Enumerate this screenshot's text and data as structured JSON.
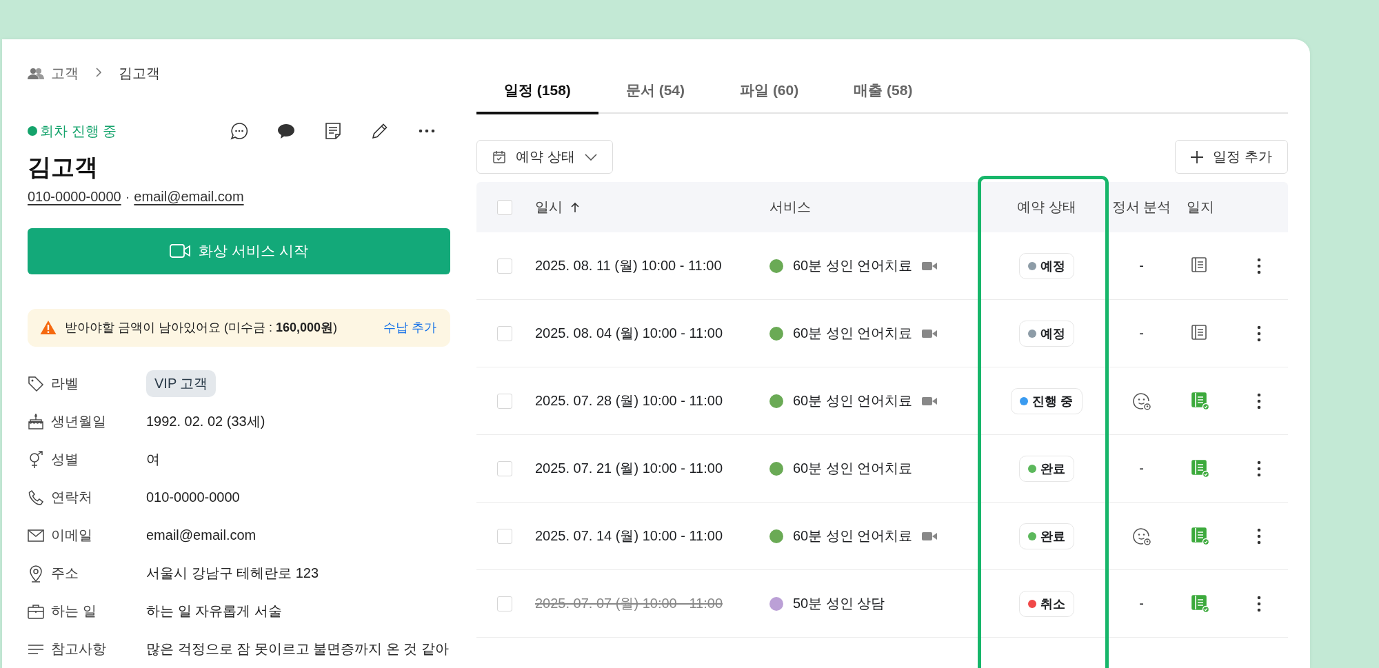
{
  "breadcrumb": [
    {
      "label": "고객"
    },
    {
      "label": "김고객"
    }
  ],
  "customer": {
    "status": "회차 진행 중",
    "name": "김고객",
    "phone": "010-0000-0000",
    "email": "email@email.com",
    "separator": "·"
  },
  "video_button": "화상 서비스 시작",
  "alert": {
    "message": "받아야할 금액이 남아있어요 (미수금 : **160,000원**)",
    "action": "수납 추가"
  },
  "details": [
    {
      "kind": "tag",
      "label": "라벨",
      "value": "VIP 고객"
    },
    {
      "kind": "text",
      "label": "생년월일",
      "value": "1992. 02. 02 (33세)"
    },
    {
      "kind": "text",
      "label": "성별",
      "value": "여"
    },
    {
      "kind": "text",
      "label": "연락처",
      "value": "010-0000-0000"
    },
    {
      "kind": "text",
      "label": "이메일",
      "value": "email@email.com"
    },
    {
      "kind": "text",
      "label": "주소",
      "value": "서울시 강남구 테헤란로 123"
    },
    {
      "kind": "text",
      "label": "하는 일",
      "value": "하는 일 자유롭게 서술"
    },
    {
      "kind": "text",
      "label": "참고사항",
      "value": "많은 걱정으로 잠 못이르고 불면증까지 온 것 같아"
    }
  ],
  "tabs": [
    {
      "label": "일정 (158)",
      "selected": true
    },
    {
      "label": "문서 (54)",
      "selected": false
    },
    {
      "label": "파일 (60)",
      "selected": false
    },
    {
      "label": "매출 (58)",
      "selected": false
    }
  ],
  "filter_button": "예약 상태",
  "add_button": "일정 추가",
  "table": {
    "header_checked": false,
    "columns": [
      "일시",
      "서비스",
      "예약 상태",
      "정서 분석",
      "일지"
    ],
    "rows": [
      {
        "checked": false,
        "datetime": "2025. 08. 11 (월) 10:00 - 11:00",
        "cancelled": false,
        "service": {
          "name": "60분 성인 언어치료",
          "color": "#6aaa55"
        },
        "video": true,
        "status": {
          "label": "예정",
          "color": "#8d9ca7"
        },
        "analyzed": false,
        "analysis": "-",
        "journal_written": false
      },
      {
        "checked": false,
        "datetime": "2025. 08. 04 (월) 10:00 - 11:00",
        "cancelled": false,
        "service": {
          "name": "60분 성인 언어치료",
          "color": "#6aaa55"
        },
        "video": true,
        "status": {
          "label": "예정",
          "color": "#8d9ca7"
        },
        "analyzed": false,
        "analysis": "-",
        "journal_written": false
      },
      {
        "checked": false,
        "datetime": "2025. 07. 28 (월) 10:00 - 11:00",
        "cancelled": false,
        "service": {
          "name": "60분 성인 언어치료",
          "color": "#6aaa55"
        },
        "video": true,
        "status": {
          "label": "진행 중",
          "color": "#3a9bf0"
        },
        "analyzed": true,
        "journal_written": true
      },
      {
        "checked": false,
        "datetime": "2025. 07. 21 (월) 10:00 - 11:00",
        "cancelled": false,
        "service": {
          "name": "60분 성인 언어치료",
          "color": "#6aaa55"
        },
        "video": false,
        "status": {
          "label": "완료",
          "color": "#5cb85c"
        },
        "analyzed": false,
        "analysis": "-",
        "journal_written": true
      },
      {
        "checked": false,
        "datetime": "2025. 07. 14 (월) 10:00 - 11:00",
        "cancelled": false,
        "service": {
          "name": "60분 성인 언어치료",
          "color": "#6aaa55"
        },
        "video": true,
        "status": {
          "label": "완료",
          "color": "#5cb85c"
        },
        "analyzed": true,
        "journal_written": true
      },
      {
        "checked": false,
        "datetime": "2025. 07. 07 (월) 10:00 - 11:00",
        "cancelled": true,
        "service": {
          "name": "50분 성인 상담",
          "color": "#bba0d6"
        },
        "video": false,
        "status": {
          "label": "취소",
          "color": "#f04848"
        },
        "analyzed": false,
        "analysis": "-",
        "journal_written": true
      }
    ]
  }
}
